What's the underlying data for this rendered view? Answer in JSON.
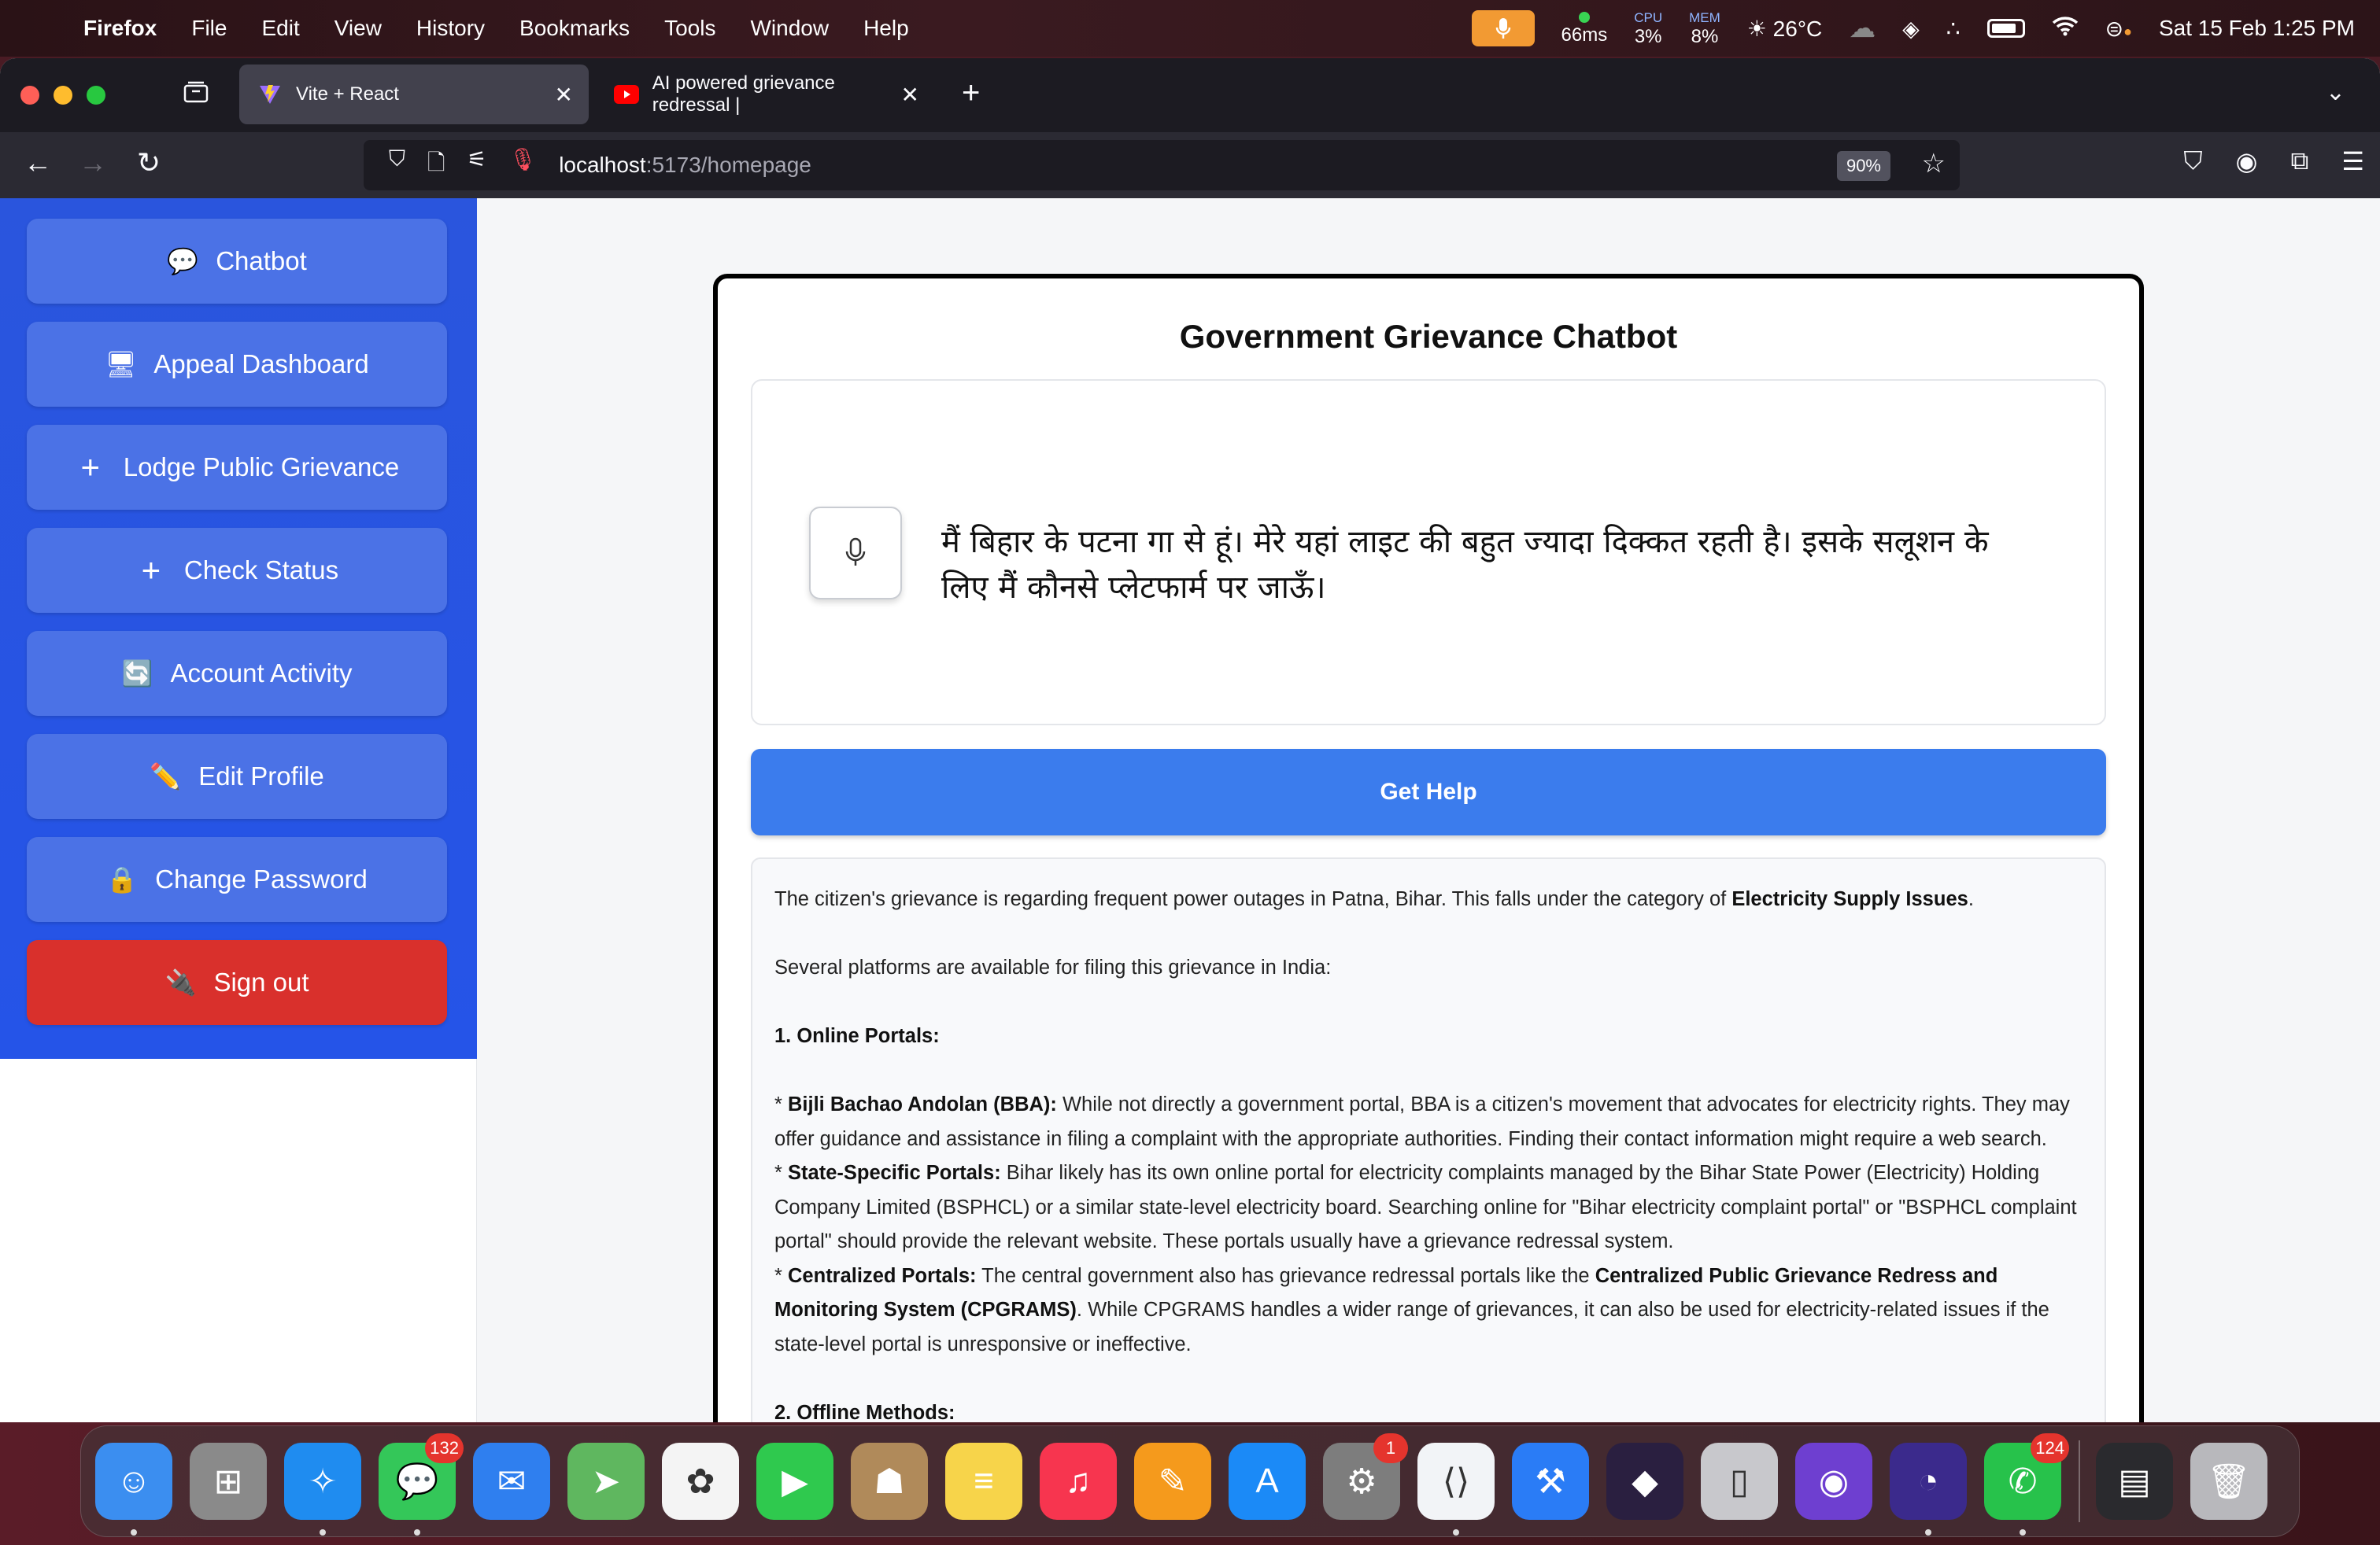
{
  "menubar": {
    "app_name": "Firefox",
    "items": [
      "File",
      "Edit",
      "View",
      "History",
      "Bookmarks",
      "Tools",
      "Window",
      "Help"
    ],
    "status": {
      "latency": "66ms",
      "cpu_label": "CPU",
      "cpu_value": "3%",
      "mem_label": "MEM",
      "mem_value": "8%",
      "weather": "26°C",
      "datetime": "Sat 15 Feb  1:25 PM"
    }
  },
  "browser": {
    "tabs": [
      {
        "title": "Vite + React",
        "active": true
      },
      {
        "title": "AI powered grievance redressal |",
        "active": false
      }
    ],
    "url_host": "localhost",
    "url_path": ":5173/homepage",
    "zoom": "90%"
  },
  "sidebar": {
    "items": [
      {
        "label": "Chatbot",
        "icon": "speech-bubble-icon"
      },
      {
        "label": "Appeal Dashboard",
        "icon": "computer-monitor-icon"
      },
      {
        "label": "Lodge Public Grievance",
        "icon": "plus-icon"
      },
      {
        "label": "Check Status",
        "icon": "plus-icon"
      },
      {
        "label": "Account Activity",
        "icon": "refresh-icon"
      },
      {
        "label": "Edit Profile",
        "icon": "pencil-icon"
      },
      {
        "label": "Change Password",
        "icon": "lock-icon"
      },
      {
        "label": "Sign out",
        "icon": "plug-icon"
      }
    ]
  },
  "chat": {
    "title": "Government Grievance Chatbot",
    "input_text": "मैं बिहार के पटना गा से हूं। मेरे यहां लाइट की बहुत ज्यादा दिक्कत रहती है। इसके सलूशन के लिए मैं कौनसे प्लेटफार्म पर जाऊँ।",
    "button_label": "Get Help",
    "response": {
      "p1_a": "The citizen's grievance is regarding frequent power outages in Patna, Bihar.  This falls under the category of ",
      "p1_b": "Electricity Supply Issues",
      "p1_c": ".",
      "p2": "Several platforms are available for filing this grievance in India:",
      "h1": "1. Online Portals:",
      "b1_pre": "* ",
      "b1_title": "Bijli Bachao Andolan (BBA):",
      "b1_text": " While not directly a government portal, BBA is a citizen's movement that advocates for electricity rights.  They may offer guidance and assistance in filing a complaint with the appropriate authorities.  Finding their contact information might require a web search.",
      "b2_pre": "* ",
      "b2_title": "State-Specific Portals:",
      "b2_text": " Bihar likely has its own online portal for electricity complaints managed by the Bihar State Power (Electricity) Holding Company Limited (BSPHCL) or a similar state-level electricity board.  Searching online for \"Bihar electricity complaint portal\" or \"BSPHCL complaint portal\" should provide the relevant website.  These portals usually have a grievance redressal system.",
      "b3_pre": "* ",
      "b3_title": "Centralized Portals:",
      "b3_text_a": "  The central government also has grievance redressal portals like the ",
      "b3_bold": "Centralized Public Grievance Redress and Monitoring System (CPGRAMS)",
      "b3_text_b": ".  While CPGRAMS handles a wider range of grievances, it can also be used for electricity-related issues if the state-level portal is unresponsive or ineffective.",
      "h2": "2. Offline Methods:"
    }
  },
  "dock": {
    "apps": [
      {
        "name": "finder",
        "color": "#3b8ef0",
        "badge": ""
      },
      {
        "name": "launchpad",
        "color": "#8a8a8a",
        "badge": ""
      },
      {
        "name": "safari",
        "color": "#1f8cf0",
        "badge": ""
      },
      {
        "name": "messages",
        "color": "#34c759",
        "badge": "132"
      },
      {
        "name": "mail",
        "color": "#2f7fef",
        "badge": ""
      },
      {
        "name": "maps",
        "color": "#5fb75f",
        "badge": ""
      },
      {
        "name": "photos",
        "color": "#f4f4f4",
        "badge": ""
      },
      {
        "name": "facetime",
        "color": "#2fc94e",
        "badge": ""
      },
      {
        "name": "contacts",
        "color": "#b08a5a",
        "badge": ""
      },
      {
        "name": "notes",
        "color": "#f7d44a",
        "badge": ""
      },
      {
        "name": "music",
        "color": "#f7354f",
        "badge": ""
      },
      {
        "name": "pages",
        "color": "#f59a1c",
        "badge": ""
      },
      {
        "name": "app-store",
        "color": "#1b8af7",
        "badge": ""
      },
      {
        "name": "system-settings",
        "color": "#7d7d7d",
        "badge": "1"
      },
      {
        "name": "vscode",
        "color": "#f2f4f7",
        "badge": ""
      },
      {
        "name": "xcode",
        "color": "#2a7cf6",
        "badge": ""
      },
      {
        "name": "obsidian",
        "color": "#2a1f40",
        "badge": ""
      },
      {
        "name": "simulator",
        "color": "#c8c8cc",
        "badge": ""
      },
      {
        "name": "github-desktop",
        "color": "#6e3fd0",
        "badge": ""
      },
      {
        "name": "firefox",
        "color": "#3b2a8c",
        "badge": ""
      },
      {
        "name": "whatsapp",
        "color": "#27c24b",
        "badge": "124"
      }
    ],
    "extras": [
      {
        "name": "downloads-stack",
        "color": "#2a2a2e"
      },
      {
        "name": "trash",
        "color": "#b8b8bc"
      }
    ]
  }
}
